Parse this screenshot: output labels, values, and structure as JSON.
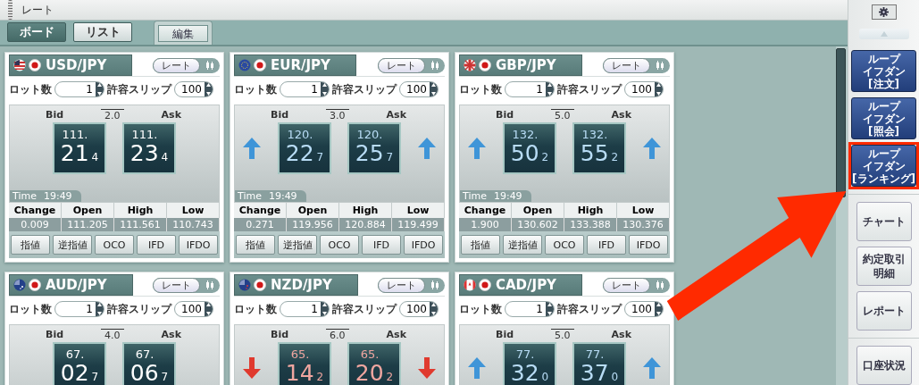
{
  "window": {
    "title": "レート"
  },
  "view_tabs": [
    {
      "label": "ボード",
      "selected": true
    },
    {
      "label": "リスト",
      "selected": false
    }
  ],
  "edit_tab": {
    "label": "編集"
  },
  "cards": [
    {
      "pair": "USD/JPY",
      "mode_toggle": "レート",
      "lot_label": "ロット数",
      "lot": "1",
      "slip_label": "許容スリップ",
      "slip": "100",
      "bid_label": "Bid",
      "ask_label": "Ask",
      "spread": "2.0",
      "rising": false,
      "falling": false,
      "bid": {
        "big": "111.",
        "pips": "21",
        "frac": "4"
      },
      "ask": {
        "big": "111.",
        "pips": "23",
        "frac": "4"
      },
      "time_label": "Time",
      "time": "19:49",
      "stats": [
        {
          "label": "Change",
          "value": "0.009"
        },
        {
          "label": "Open",
          "value": "111.205"
        },
        {
          "label": "High",
          "value": "111.561"
        },
        {
          "label": "Low",
          "value": "110.743"
        }
      ],
      "orders": [
        "指値",
        "逆指値",
        "OCO",
        "IFD",
        "IFDO"
      ]
    },
    {
      "pair": "EUR/JPY",
      "mode_toggle": "レート",
      "lot_label": "ロット数",
      "lot": "1",
      "slip_label": "許容スリップ",
      "slip": "100",
      "bid_label": "Bid",
      "ask_label": "Ask",
      "spread": "3.0",
      "rising": true,
      "falling": false,
      "bid": {
        "big": "120.",
        "pips": "22",
        "frac": "7"
      },
      "ask": {
        "big": "120.",
        "pips": "25",
        "frac": "7"
      },
      "time_label": "Time",
      "time": "19:49",
      "stats": [
        {
          "label": "Change",
          "value": "0.271"
        },
        {
          "label": "Open",
          "value": "119.956"
        },
        {
          "label": "High",
          "value": "120.884"
        },
        {
          "label": "Low",
          "value": "119.499"
        }
      ],
      "orders": [
        "指値",
        "逆指値",
        "OCO",
        "IFD",
        "IFDO"
      ]
    },
    {
      "pair": "GBP/JPY",
      "mode_toggle": "レート",
      "lot_label": "ロット数",
      "lot": "1",
      "slip_label": "許容スリップ",
      "slip": "100",
      "bid_label": "Bid",
      "ask_label": "Ask",
      "spread": "5.0",
      "rising": true,
      "falling": false,
      "bid": {
        "big": "132.",
        "pips": "50",
        "frac": "2"
      },
      "ask": {
        "big": "132.",
        "pips": "55",
        "frac": "2"
      },
      "time_label": "Time",
      "time": "19:49",
      "stats": [
        {
          "label": "Change",
          "value": "1.900"
        },
        {
          "label": "Open",
          "value": "130.602"
        },
        {
          "label": "High",
          "value": "133.388"
        },
        {
          "label": "Low",
          "value": "130.376"
        }
      ],
      "orders": [
        "指値",
        "逆指値",
        "OCO",
        "IFD",
        "IFDO"
      ]
    },
    {
      "pair": "AUD/JPY",
      "mode_toggle": "レート",
      "lot_label": "ロット数",
      "lot": "1",
      "slip_label": "許容スリップ",
      "slip": "100",
      "bid_label": "Bid",
      "ask_label": "Ask",
      "spread": "4.0",
      "rising": false,
      "falling": false,
      "bid": {
        "big": "67.",
        "pips": "02",
        "frac": "7"
      },
      "ask": {
        "big": "67.",
        "pips": "06",
        "frac": "7"
      }
    },
    {
      "pair": "NZD/JPY",
      "mode_toggle": "レート",
      "lot_label": "ロット数",
      "lot": "1",
      "slip_label": "許容スリップ",
      "slip": "100",
      "bid_label": "Bid",
      "ask_label": "Ask",
      "spread": "6.0",
      "rising": false,
      "falling": true,
      "bid": {
        "big": "65.",
        "pips": "14",
        "frac": "2"
      },
      "ask": {
        "big": "65.",
        "pips": "20",
        "frac": "2"
      }
    },
    {
      "pair": "CAD/JPY",
      "mode_toggle": "レート",
      "lot_label": "ロット数",
      "lot": "1",
      "slip_label": "許容スリップ",
      "slip": "100",
      "bid_label": "Bid",
      "ask_label": "Ask",
      "spread": "5.0",
      "rising": true,
      "falling": false,
      "bid": {
        "big": "77.",
        "pips": "32",
        "frac": "0"
      },
      "ask": {
        "big": "77.",
        "pips": "37",
        "frac": "0"
      }
    }
  ],
  "sidebar": [
    {
      "kind": "loop",
      "lines": [
        "ループ",
        "イフダン",
        "[注文]"
      ],
      "highlighted": false
    },
    {
      "kind": "loop",
      "lines": [
        "ループ",
        "イフダン",
        "[照会]"
      ],
      "highlighted": false
    },
    {
      "kind": "loop",
      "lines": [
        "ループ",
        "イフダン",
        "[ランキング]"
      ],
      "highlighted": true
    },
    {
      "kind": "plain",
      "lines": [
        "チャート"
      ],
      "highlighted": false
    },
    {
      "kind": "plain",
      "lines": [
        "約定取引",
        "明細"
      ],
      "highlighted": false
    },
    {
      "kind": "plain",
      "lines": [
        "レポート"
      ],
      "highlighted": false
    },
    {
      "kind": "plain",
      "lines": [
        "口座状況"
      ],
      "highlighted": false
    }
  ]
}
